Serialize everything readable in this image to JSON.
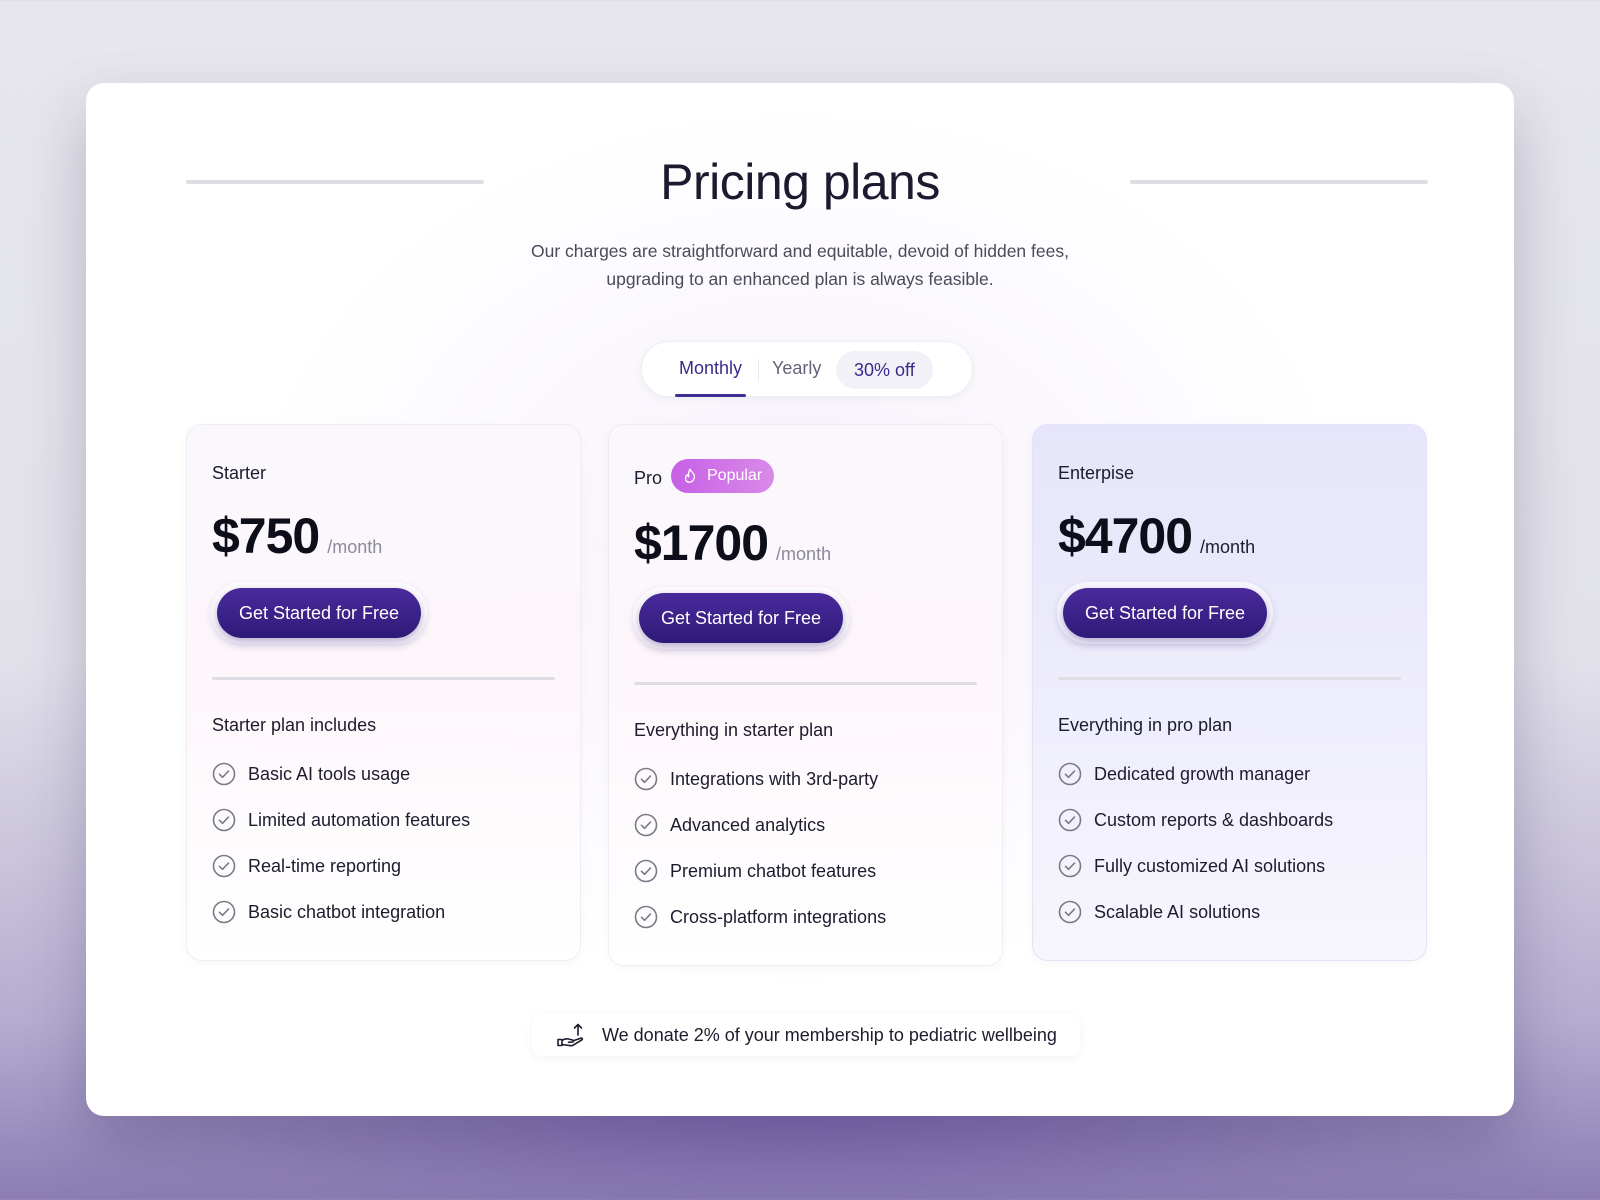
{
  "header": {
    "title": "Pricing plans",
    "subtitle_line1": "Our charges are straightforward and equitable, devoid of hidden fees,",
    "subtitle_line2": "upgrading to an enhanced plan is always feasible."
  },
  "billing_toggle": {
    "monthly": "Monthly",
    "yearly": "Yearly",
    "discount": "30% off",
    "selected": "Monthly"
  },
  "plans": [
    {
      "name": "Starter",
      "price": "$750",
      "period": "/month",
      "cta": "Get Started for Free",
      "includes_title": "Starter plan includes",
      "features": [
        "Basic AI tools usage",
        "Limited automation features",
        "Real-time reporting",
        "Basic chatbot integration"
      ]
    },
    {
      "name": "Pro",
      "badge": "Popular",
      "price": "$1700",
      "period": "/month",
      "cta": "Get Started for Free",
      "includes_title": "Everything in starter plan",
      "features": [
        "Integrations with 3rd-party",
        "Advanced analytics",
        "Premium chatbot features",
        "Cross-platform integrations"
      ]
    },
    {
      "name": "Enterpise",
      "price": "$4700",
      "period": "/month",
      "cta": "Get Started for Free",
      "includes_title": "Everything in pro plan",
      "features": [
        "Dedicated growth manager",
        "Custom reports & dashboards",
        "Fully customized AI solutions",
        "Scalable AI solutions"
      ]
    }
  ],
  "footer": {
    "icon": "hand-donate-icon",
    "text": "We donate 2% of your membership to pediatric wellbeing"
  },
  "colors": {
    "accent": "#3f2d96",
    "button": "#3a2288",
    "badge": "#cf72e7",
    "enterprise_bg": "#e7e6fb"
  }
}
